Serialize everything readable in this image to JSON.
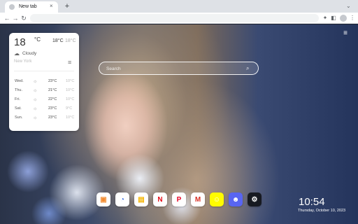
{
  "tab": {
    "title": "New tab",
    "close": "×",
    "new_tab": "+"
  },
  "toolbar": {
    "back": "←",
    "forward": "→",
    "reload": "↻",
    "ext1": "✦",
    "ext2": "◧",
    "ext3": "☆",
    "more": "⋮"
  },
  "menu_icon": "≡",
  "weather": {
    "temp": "18",
    "deg_unit": "°C",
    "high": "18°C",
    "low": "18°C",
    "condition": "Cloudy",
    "city": "New York",
    "forecast": [
      {
        "day": "Wed.",
        "icon": "sun-icon",
        "high": "23°C",
        "low": "10°C"
      },
      {
        "day": "Thu.",
        "icon": "sun-icon",
        "high": "21°C",
        "low": "10°C"
      },
      {
        "day": "Fri.",
        "icon": "sun-icon",
        "high": "22°C",
        "low": "10°C"
      },
      {
        "day": "Sat.",
        "icon": "sun-icon",
        "high": "23°C",
        "low": "9°C"
      },
      {
        "day": "Sun.",
        "icon": "sun-icon",
        "high": "23°C",
        "low": "10°C"
      }
    ]
  },
  "search": {
    "placeholder": "Search"
  },
  "dock": [
    {
      "name": "wallpaper-app",
      "glyph": "▣",
      "bg": "#ffffff",
      "fg": "#f28b30"
    },
    {
      "name": "compass-app",
      "glyph": "◔",
      "bg": "#ffffff",
      "fg": "#3b6fe0"
    },
    {
      "name": "notes-app",
      "glyph": "▤",
      "bg": "#ffffff",
      "fg": "#f4b400"
    },
    {
      "name": "netflix",
      "glyph": "N",
      "bg": "#ffffff",
      "fg": "#e50914"
    },
    {
      "name": "pinterest",
      "glyph": "P",
      "bg": "#ffffff",
      "fg": "#e60023"
    },
    {
      "name": "gmail",
      "glyph": "M",
      "bg": "#ffffff",
      "fg": "#d93025"
    },
    {
      "name": "snapchat",
      "glyph": "☺",
      "bg": "#fffc00",
      "fg": "#ffffff"
    },
    {
      "name": "discord",
      "glyph": "☻",
      "bg": "#5865f2",
      "fg": "#ffffff"
    },
    {
      "name": "steam",
      "glyph": "⚙",
      "bg": "#171a21",
      "fg": "#ffffff"
    }
  ],
  "clock": {
    "time": "10:54",
    "date": "Thursday, October 10, 2023"
  }
}
